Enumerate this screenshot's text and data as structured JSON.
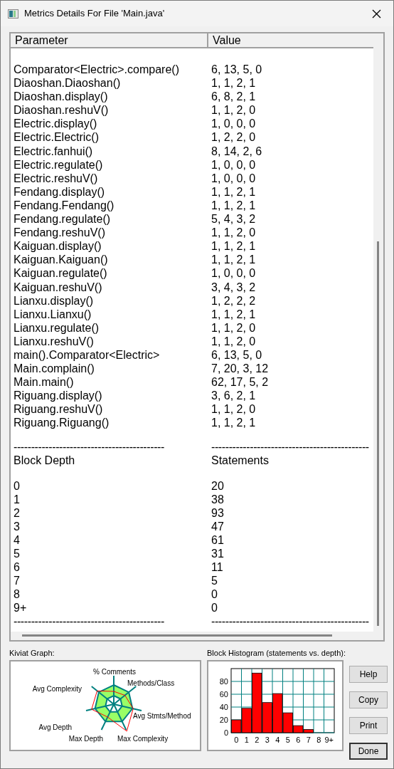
{
  "window": {
    "title": "Metrics Details For File 'Main.java'"
  },
  "table": {
    "columns": [
      "Parameter",
      "Value"
    ],
    "rows": [
      {
        "parameter": "Comparator<Electric>.compare()",
        "value": "6, 13, 5, 0"
      },
      {
        "parameter": "Diaoshan.Diaoshan()",
        "value": "1, 1, 2, 1"
      },
      {
        "parameter": "Diaoshan.display()",
        "value": "6, 8, 2, 1"
      },
      {
        "parameter": "Diaoshan.reshuV()",
        "value": "1, 1, 2, 0"
      },
      {
        "parameter": "Electric.display()",
        "value": "1, 0, 0, 0"
      },
      {
        "parameter": "Electric.Electric()",
        "value": "1, 2, 2, 0"
      },
      {
        "parameter": "Electric.fanhui()",
        "value": "8, 14, 2, 6"
      },
      {
        "parameter": "Electric.regulate()",
        "value": "1, 0, 0, 0"
      },
      {
        "parameter": "Electric.reshuV()",
        "value": "1, 0, 0, 0"
      },
      {
        "parameter": "Fendang.display()",
        "value": "1, 1, 2, 1"
      },
      {
        "parameter": "Fendang.Fendang()",
        "value": "1, 1, 2, 1"
      },
      {
        "parameter": "Fendang.regulate()",
        "value": "5, 4, 3, 2"
      },
      {
        "parameter": "Fendang.reshuV()",
        "value": "1, 1, 2, 0"
      },
      {
        "parameter": "Kaiguan.display()",
        "value": "1, 1, 2, 1"
      },
      {
        "parameter": "Kaiguan.Kaiguan()",
        "value": "1, 1, 2, 1"
      },
      {
        "parameter": "Kaiguan.regulate()",
        "value": "1, 0, 0, 0"
      },
      {
        "parameter": "Kaiguan.reshuV()",
        "value": "3, 4, 3, 2"
      },
      {
        "parameter": "Lianxu.display()",
        "value": "1, 2, 2, 2"
      },
      {
        "parameter": "Lianxu.Lianxu()",
        "value": "1, 1, 2, 1"
      },
      {
        "parameter": "Lianxu.regulate()",
        "value": "1, 1, 2, 0"
      },
      {
        "parameter": "Lianxu.reshuV()",
        "value": "1, 1, 2, 0"
      },
      {
        "parameter": "main().Comparator<Electric>",
        "value": "6, 13, 5, 0"
      },
      {
        "parameter": "Main.complain()",
        "value": "7, 20, 3, 12"
      },
      {
        "parameter": "Main.main()",
        "value": "62, 17, 5, 2"
      },
      {
        "parameter": "Riguang.display()",
        "value": "3, 6, 2, 1"
      },
      {
        "parameter": "Riguang.reshuV()",
        "value": "1, 1, 2, 0"
      },
      {
        "parameter": "Riguang.Riguang()",
        "value": "1, 1, 2, 1"
      }
    ]
  },
  "separator_top": {
    "left": "-------------------------------------------",
    "right": "---------------------------------------------"
  },
  "depth_table": {
    "columns": [
      "Block Depth",
      "Statements"
    ],
    "rows": [
      {
        "depth": "0",
        "statements": "20"
      },
      {
        "depth": "1",
        "statements": "38"
      },
      {
        "depth": "2",
        "statements": "93"
      },
      {
        "depth": "3",
        "statements": "47"
      },
      {
        "depth": "4",
        "statements": "61"
      },
      {
        "depth": "5",
        "statements": "31"
      },
      {
        "depth": "6",
        "statements": "11"
      },
      {
        "depth": "7",
        "statements": "5"
      },
      {
        "depth": "8",
        "statements": "0"
      },
      {
        "depth": "9+",
        "statements": "0"
      }
    ]
  },
  "separator_bottom": {
    "left": "-------------------------------------------",
    "right": "---------------------------------------------"
  },
  "kiviat": {
    "label": "Kiviat Graph:",
    "axes": [
      "% Comments",
      "Methods/Class",
      "Avg Complexity",
      "Avg Stmts/Method",
      "Avg Depth",
      "Max Depth",
      "Max Complexity"
    ]
  },
  "histogram": {
    "label": "Block Histogram (statements vs. depth):",
    "chart_data": {
      "type": "bar",
      "categories": [
        "0",
        "1",
        "2",
        "3",
        "4",
        "5",
        "6",
        "7",
        "8",
        "9+"
      ],
      "values": [
        20,
        38,
        93,
        47,
        61,
        31,
        11,
        5,
        0,
        0
      ],
      "ylim": [
        0,
        100
      ],
      "yticks": [
        0,
        20,
        40,
        60,
        80
      ],
      "grid": true
    }
  },
  "buttons": [
    "Help",
    "Copy",
    "Print",
    "Done"
  ]
}
